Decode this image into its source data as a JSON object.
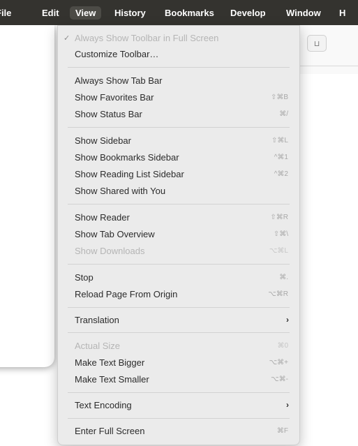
{
  "menubar": {
    "items": [
      "File",
      "Edit",
      "View",
      "History",
      "Bookmarks",
      "Develop",
      "Window",
      "H"
    ],
    "active": "View"
  },
  "toolbar": {
    "button_label": "⊔"
  },
  "menu": {
    "items": [
      {
        "label": "Always Show Toolbar in Full Screen",
        "check": "✓",
        "shortcut": "",
        "disabled": true
      },
      {
        "label": "Customize Toolbar…",
        "shortcut": ""
      },
      {
        "label": "Always Show Tab Bar",
        "shortcut": ""
      },
      {
        "label": "Show Favorites Bar",
        "shortcut": "⇧⌘B"
      },
      {
        "label": "Show Status Bar",
        "shortcut": "⌘/"
      },
      {
        "label": "Show Sidebar",
        "shortcut": "⇧⌘L"
      },
      {
        "label": "Show Bookmarks Sidebar",
        "shortcut": "^⌘1"
      },
      {
        "label": "Show Reading List Sidebar",
        "shortcut": "^⌘2"
      },
      {
        "label": "Show Shared with You",
        "shortcut": ""
      },
      {
        "label": "Show Reader",
        "shortcut": "⇧⌘R"
      },
      {
        "label": "Show Tab Overview",
        "shortcut": "⇧⌘\\"
      },
      {
        "label": "Show Downloads",
        "shortcut": "⌥⌘L",
        "disabled": true
      },
      {
        "label": "Stop",
        "shortcut": "⌘."
      },
      {
        "label": "Reload Page From Origin",
        "shortcut": "⌥⌘R"
      },
      {
        "label": "Translation",
        "submenu": "›"
      },
      {
        "label": "Actual Size",
        "shortcut": "⌘0",
        "disabled": true
      },
      {
        "label": "Make Text Bigger",
        "shortcut": "⌥⌘+"
      },
      {
        "label": "Make Text Smaller",
        "shortcut": "⌥⌘-"
      },
      {
        "label": "Text Encoding",
        "submenu": "›"
      },
      {
        "label": "Enter Full Screen",
        "shortcut": "⌘F"
      }
    ]
  },
  "colors": {
    "menubar_bg": "#34332f",
    "menu_bg": "#ebebeb",
    "text": "#2b2b2b",
    "disabled_text": "#b5b5b5"
  }
}
